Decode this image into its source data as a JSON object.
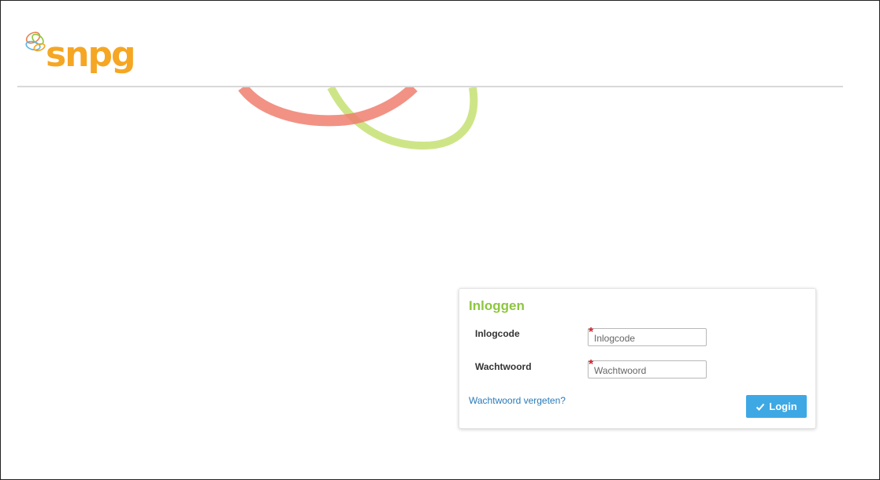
{
  "brand": {
    "logo_text": "snpg",
    "accent_orange": "#f5a623",
    "accent_green": "#8dc63f",
    "accent_red": "#f08070",
    "icon": "intertwined-loops-logo-icon"
  },
  "login": {
    "title": "Inloggen",
    "username_label": "Inlogcode",
    "username_placeholder": "Inlogcode",
    "password_label": "Wachtwoord",
    "password_placeholder": "Wachtwoord",
    "required_marker": "*",
    "forgot_link": "Wachtwoord vergeten?",
    "submit_label": "Login",
    "submit_icon": "check-icon",
    "button_color": "#3ea8e5",
    "link_color": "#2a7ab8"
  }
}
